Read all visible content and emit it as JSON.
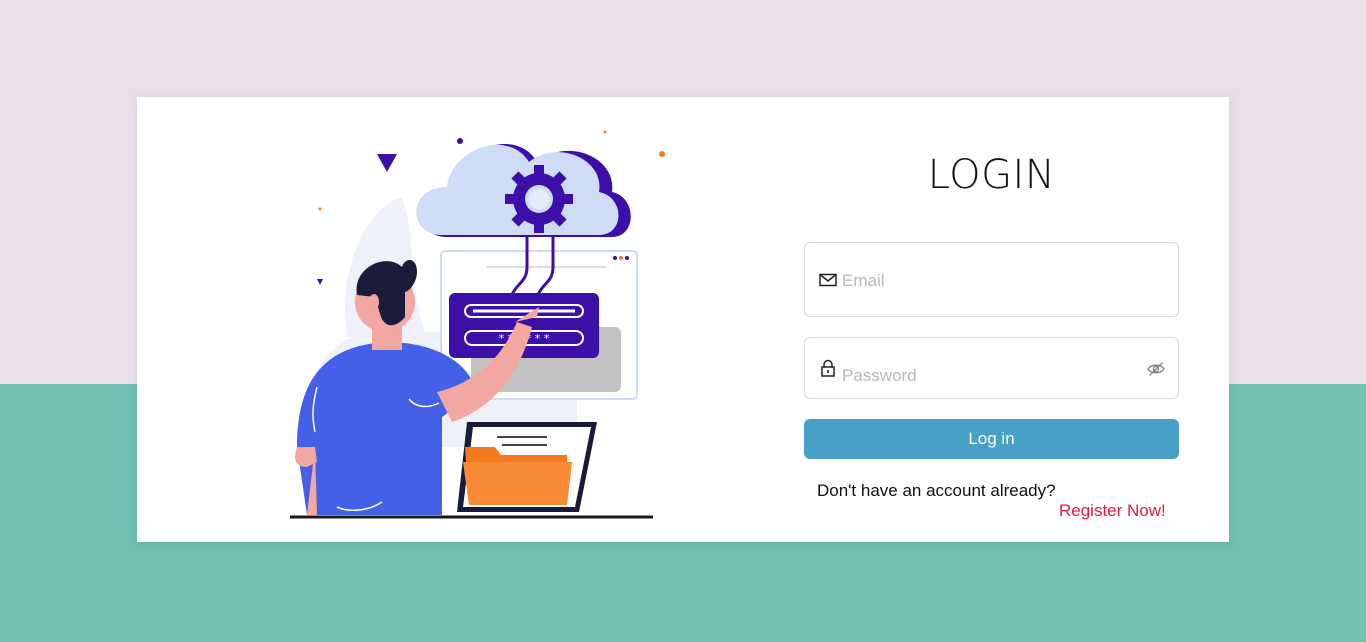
{
  "login": {
    "title": "LOGIN",
    "email": {
      "placeholder": "Email",
      "value": ""
    },
    "password": {
      "placeholder": "Password",
      "value": ""
    },
    "submit_label": "Log in",
    "no_account_text": "Don't have an account already?",
    "register_link": "Register Now!"
  },
  "icons": {
    "email": "envelope-icon",
    "password": "lock-icon",
    "toggle_visibility": "eye-slash-icon"
  },
  "colors": {
    "background_top": "#e9dfe8",
    "background_bottom": "#70c1b3",
    "button": "#4a9fc6",
    "link": "#e8193c",
    "illustration_primary": "#3b0fa8",
    "illustration_shirt": "#4460e6",
    "illustration_folder": "#f47a20"
  }
}
